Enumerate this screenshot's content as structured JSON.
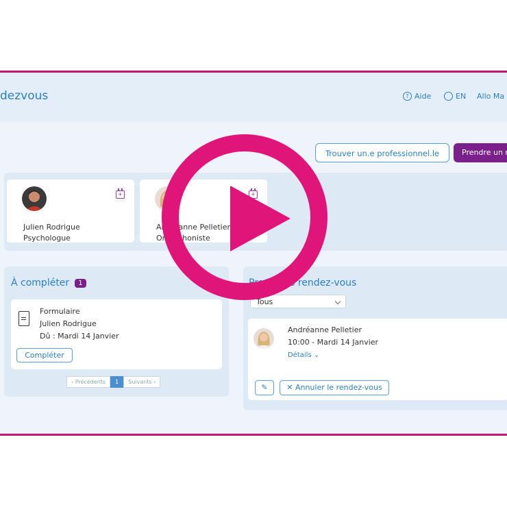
{
  "header": {
    "brand": "dezvous",
    "aide": "Aide",
    "lang": "EN",
    "allo": "Allo Ma"
  },
  "actions": {
    "find_pro": "Trouver un.e professionnel.le",
    "book": "Prendre un r"
  },
  "professionals": [
    {
      "name": "Julien Rodrigue",
      "role": "Psychologue"
    },
    {
      "name": "Andréanne Pelletier",
      "role": "Orthophoniste"
    }
  ],
  "tasks": {
    "title": "À compléter",
    "count": "1",
    "item": {
      "type": "Formulaire",
      "pro": "Julien Rodrigue",
      "due": "Dû : Mardi 14 Janvier",
      "action": "Compléter"
    },
    "pager": {
      "prev": "‹ Précédents",
      "page": "1",
      "next": "Suivants ›"
    }
  },
  "appointments": {
    "title": "Prochains rendez-vous",
    "filter": "Tous",
    "item": {
      "name": "Andréanne Pelletier",
      "time": "10:00 - Mardi 14 Janvier",
      "details": "Détails"
    },
    "cancel": "Annuler le rendez-vous"
  },
  "colors": {
    "accent": "#2a7fc1",
    "primary": "#7b1f8a",
    "overlay": "#e0157a"
  }
}
